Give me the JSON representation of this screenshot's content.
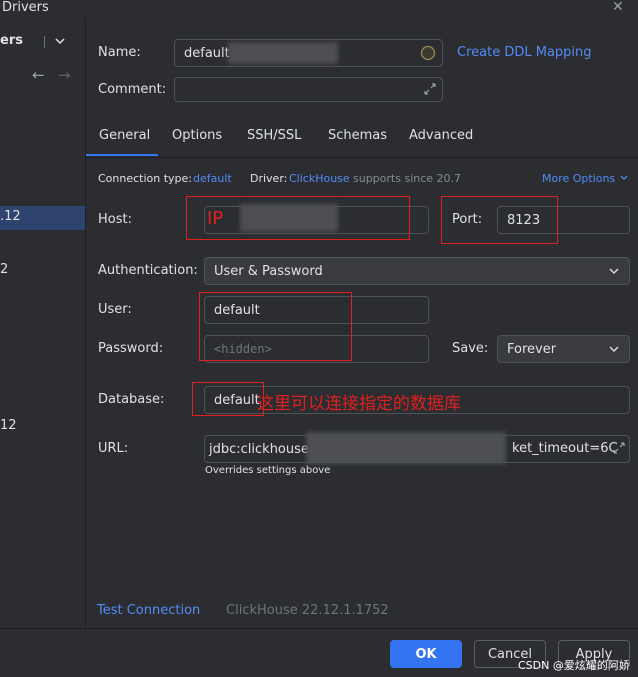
{
  "window": {
    "title": "Drivers",
    "close": "✕"
  },
  "sidebar": {
    "header": "ers",
    "items": [
      {
        "label": ".12",
        "selected": true
      },
      {
        "label": "2"
      },
      {
        "label": "12"
      }
    ]
  },
  "general": {
    "name_label": "Name:",
    "name_value": "default",
    "create_ddl_link": "Create DDL Mapping",
    "comment_label": "Comment:",
    "tabs": [
      "General",
      "Options",
      "SSH/SSL",
      "Schemas",
      "Advanced"
    ],
    "active_tab": "General"
  },
  "connection": {
    "type_label": "Connection type:",
    "type_value": "default",
    "driver_label": "Driver:",
    "driver_value": "ClickHouse",
    "driver_note": "supports since 20.7",
    "more_options": "More Options",
    "host_label": "Host:",
    "host_annotation": "IP",
    "port_label": "Port:",
    "port_value": "8123",
    "auth_label": "Authentication:",
    "auth_value": "User & Password",
    "user_label": "User:",
    "user_value": "default",
    "password_label": "Password:",
    "password_placeholder": "<hidden>",
    "save_label": "Save:",
    "save_value": "Forever",
    "database_label": "Database:",
    "database_value": "default",
    "database_annotation": "这里可以连接指定的数据库",
    "url_label": "URL:",
    "url_start": "jdbc:clickhouse",
    "url_end": "ket_timeout=6C",
    "url_note": "Overrides settings above"
  },
  "footer": {
    "test_connection": "Test Connection",
    "version": "ClickHouse 22.12.1.1752",
    "ok": "OK",
    "cancel": "Cancel",
    "apply": "Apply",
    "watermark": "CSDN @爱炫耀的阿娇"
  },
  "colors": {
    "background": "#2b2d30",
    "accent": "#3574f0",
    "link": "#548af7",
    "annotation": "#e02020"
  }
}
